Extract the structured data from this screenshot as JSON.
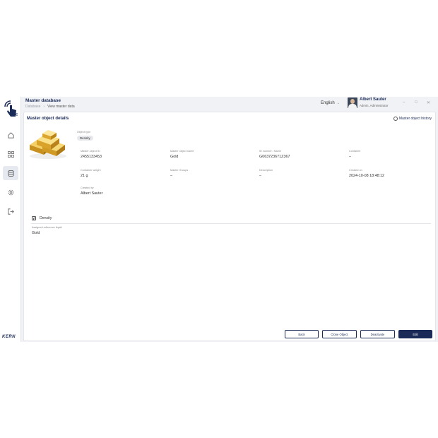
{
  "brand": {
    "logo_text": "KERN",
    "accent": "#1b2b57"
  },
  "header": {
    "title": "Master database",
    "breadcrumb": [
      "Database",
      "View master data"
    ],
    "language": "English",
    "user": {
      "name": "Albert Sauter",
      "role": "Admin, Administrator"
    }
  },
  "sidebar": {
    "items": [
      {
        "icon": "home-icon"
      },
      {
        "icon": "grid-icon"
      },
      {
        "icon": "database-icon",
        "active": true
      },
      {
        "icon": "gear-icon"
      },
      {
        "icon": "logout-icon"
      }
    ]
  },
  "details": {
    "title": "Master object details",
    "history_link": "Master object history",
    "object_type_label": "Object type",
    "object_type": "Density",
    "fields": [
      {
        "label": "Master object ID",
        "value": "2455133453"
      },
      {
        "label": "Master object name",
        "value": "Gold"
      },
      {
        "label": "ID number / Name",
        "value": "G063723671Z367"
      },
      {
        "label": "Container",
        "value": "–"
      },
      {
        "label": "Container weight",
        "value": "21 g"
      },
      {
        "label": "Master Groups",
        "value": "–"
      },
      {
        "label": "Description",
        "value": "–"
      },
      {
        "label": "Created on",
        "value": "2024-10-08 18:48:12"
      },
      {
        "label": "Created by",
        "value": "Albert Sauter"
      }
    ]
  },
  "density": {
    "section_title": "Density",
    "liquid_label": "Assigned reference liquid",
    "liquid_value": "Gold"
  },
  "actions": {
    "back": "Back",
    "clone": "Clone Object",
    "deactivate": "Deactivate",
    "edit": "Edit"
  }
}
